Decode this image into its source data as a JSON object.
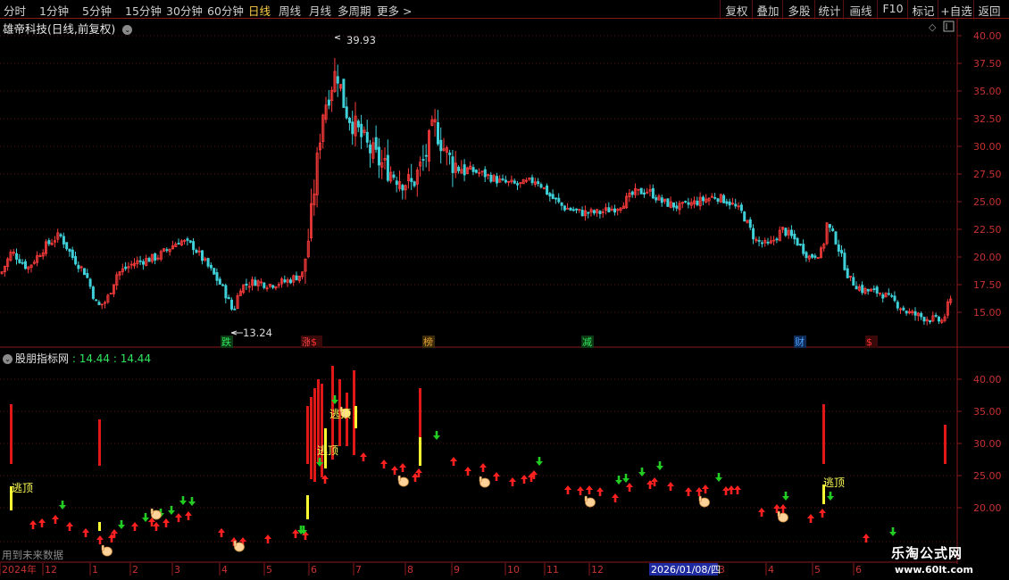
{
  "toolbar": {
    "periods": [
      "分时",
      "1分钟",
      "5分钟",
      "15分钟",
      "30分钟",
      "60分钟",
      "日线",
      "周线",
      "月线",
      "多周期",
      "更多 >"
    ],
    "active_period": "日线",
    "right_buttons": [
      "复权",
      "叠加",
      "多股",
      "统计",
      "画线",
      "F10",
      "标记",
      "+自选",
      "返回"
    ]
  },
  "main": {
    "title": "雄帝科技(日线,前复权)",
    "high_label": "39.93",
    "low_label": "13.24",
    "price_axis": [
      "40.00",
      "37.50",
      "35.00",
      "32.50",
      "30.00",
      "27.50",
      "25.00",
      "22.50",
      "20.00",
      "17.50",
      "15.00"
    ],
    "event_tags": [
      {
        "text": "跌",
        "color": "#2ee65c"
      },
      {
        "text": "涨",
        "color": "#ff4444"
      },
      {
        "text": "$",
        "color": "#ff3030"
      },
      {
        "text": "榜",
        "color": "#e0a030"
      },
      {
        "text": "减",
        "color": "#2ee65c"
      },
      {
        "text": "财",
        "color": "#4aa0ff"
      },
      {
        "text": "$",
        "color": "#ff3030"
      }
    ]
  },
  "indicator": {
    "name": "股朋指标网",
    "value1": "14.44",
    "value2": "14.44",
    "axis": [
      "40.00",
      "35.00",
      "30.00",
      "25.00",
      "20.00"
    ],
    "escape_label": "逃顶",
    "future_data_label": "用到未来数据"
  },
  "date_axis": {
    "labels": [
      "2024年",
      "12",
      "1",
      "2",
      "3",
      "4",
      "5",
      "6",
      "7",
      "8",
      "9",
      "10",
      "11",
      "12",
      "3",
      "4",
      "5",
      "6"
    ],
    "highlight_date": "2026/01/08/四"
  },
  "watermark": {
    "line1": "乐淘公式网",
    "line2": "www.60lt.com"
  },
  "colors": {
    "up": "#ff3c3c",
    "down": "#3fd0d8",
    "grid_red": "#8a1a1a",
    "signal_green": "#22cc22",
    "signal_yellow": "#ffff33"
  }
}
